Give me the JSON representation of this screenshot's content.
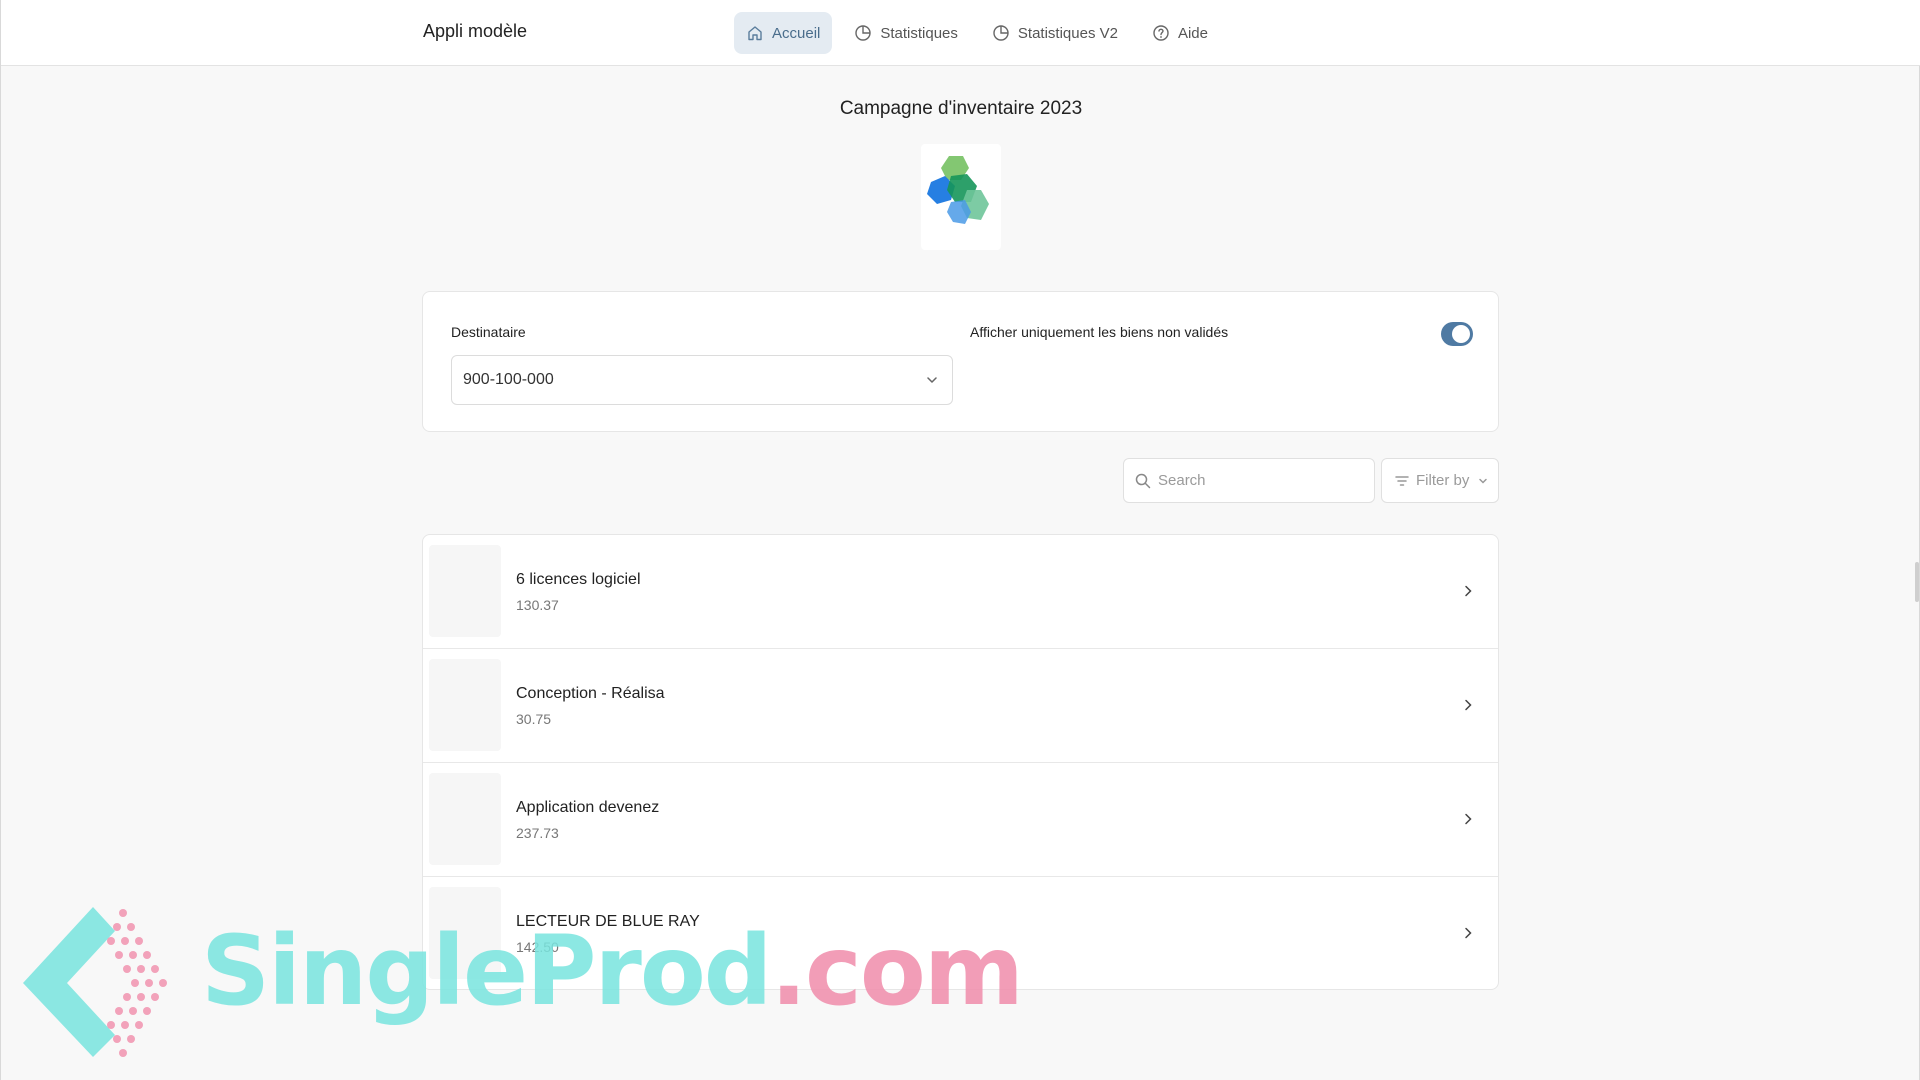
{
  "app": {
    "title": "Appli modèle"
  },
  "nav": {
    "items": [
      {
        "label": "Accueil",
        "icon": "home-icon",
        "active": true
      },
      {
        "label": "Statistiques",
        "icon": "pie-chart-icon",
        "active": false
      },
      {
        "label": "Statistiques V2",
        "icon": "pie-chart-icon",
        "active": false
      },
      {
        "label": "Aide",
        "icon": "help-circle-icon",
        "active": false
      }
    ]
  },
  "header": {
    "title": "Campagne d'inventaire 2023",
    "logo": "hexagon-cubes-logo"
  },
  "filters": {
    "recipient_label": "Destinataire",
    "recipient_value": "900-100-000",
    "toggle_label": "Afficher uniquement les biens non validés",
    "toggle_on": true
  },
  "search": {
    "placeholder": "Search"
  },
  "filter_by": {
    "label": "Filter by"
  },
  "items": [
    {
      "title": "6 licences logiciel",
      "value": "130.37"
    },
    {
      "title": "Conception - Réalisa",
      "value": "30.75"
    },
    {
      "title": "Application devenez",
      "value": "237.73"
    },
    {
      "title": "LECTEUR DE BLUE RAY",
      "value": "142.50"
    }
  ],
  "watermark": {
    "text_a": "SingleProd",
    "text_b": ".com"
  },
  "colors": {
    "accent": "#4f7aa3",
    "nav_active_bg": "#e4ebf2",
    "page_bg": "#f8f8f8",
    "watermark_cyan": "#78e4de",
    "watermark_pink": "#f08caa"
  }
}
